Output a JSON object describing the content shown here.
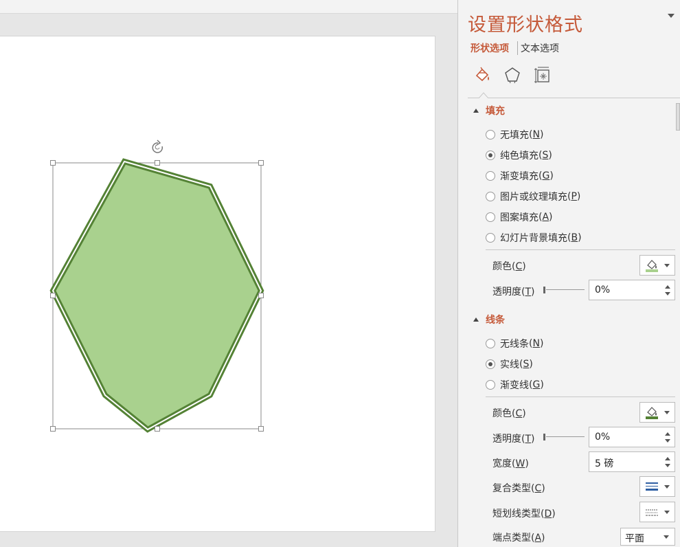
{
  "panel": {
    "title": "设置形状格式",
    "tabs": {
      "shape_options": "形状选项",
      "text_options": "文本选项"
    },
    "icons": [
      "fill-line-icon",
      "effects-pentagon-icon",
      "size-properties-icon"
    ]
  },
  "fill": {
    "heading": "填充",
    "options": [
      {
        "label": "无填充",
        "key": "N",
        "selected": false
      },
      {
        "label": "纯色填充",
        "key": "S",
        "selected": true
      },
      {
        "label": "渐变填充",
        "key": "G",
        "selected": false
      },
      {
        "label": "图片或纹理填充",
        "key": "P",
        "selected": false
      },
      {
        "label": "图案填充",
        "key": "A",
        "selected": false
      },
      {
        "label": "幻灯片背景填充",
        "key": "B",
        "selected": false
      }
    ],
    "color_label": "颜色",
    "color_key": "C",
    "color_value": "#a9d18e",
    "transparency_label": "透明度",
    "transparency_key": "T",
    "transparency_value": "0%"
  },
  "line": {
    "heading": "线条",
    "options": [
      {
        "label": "无线条",
        "key": "N",
        "selected": false
      },
      {
        "label": "实线",
        "key": "S",
        "selected": true
      },
      {
        "label": "渐变线",
        "key": "G",
        "selected": false
      }
    ],
    "color_label": "颜色",
    "color_key": "C",
    "color_value": "#548235",
    "transparency_label": "透明度",
    "transparency_key": "T",
    "transparency_value": "0%",
    "width_label": "宽度",
    "width_key": "W",
    "width_value": "5 磅",
    "compound_label": "复合类型",
    "compound_key": "C",
    "dash_label": "短划线类型",
    "dash_key": "D",
    "cap_label": "端点类型",
    "cap_key": "A",
    "cap_value": "平面"
  },
  "colors": {
    "accent": "#c55a3a",
    "shape_fill": "#a9d18e",
    "shape_line": "#548235"
  }
}
